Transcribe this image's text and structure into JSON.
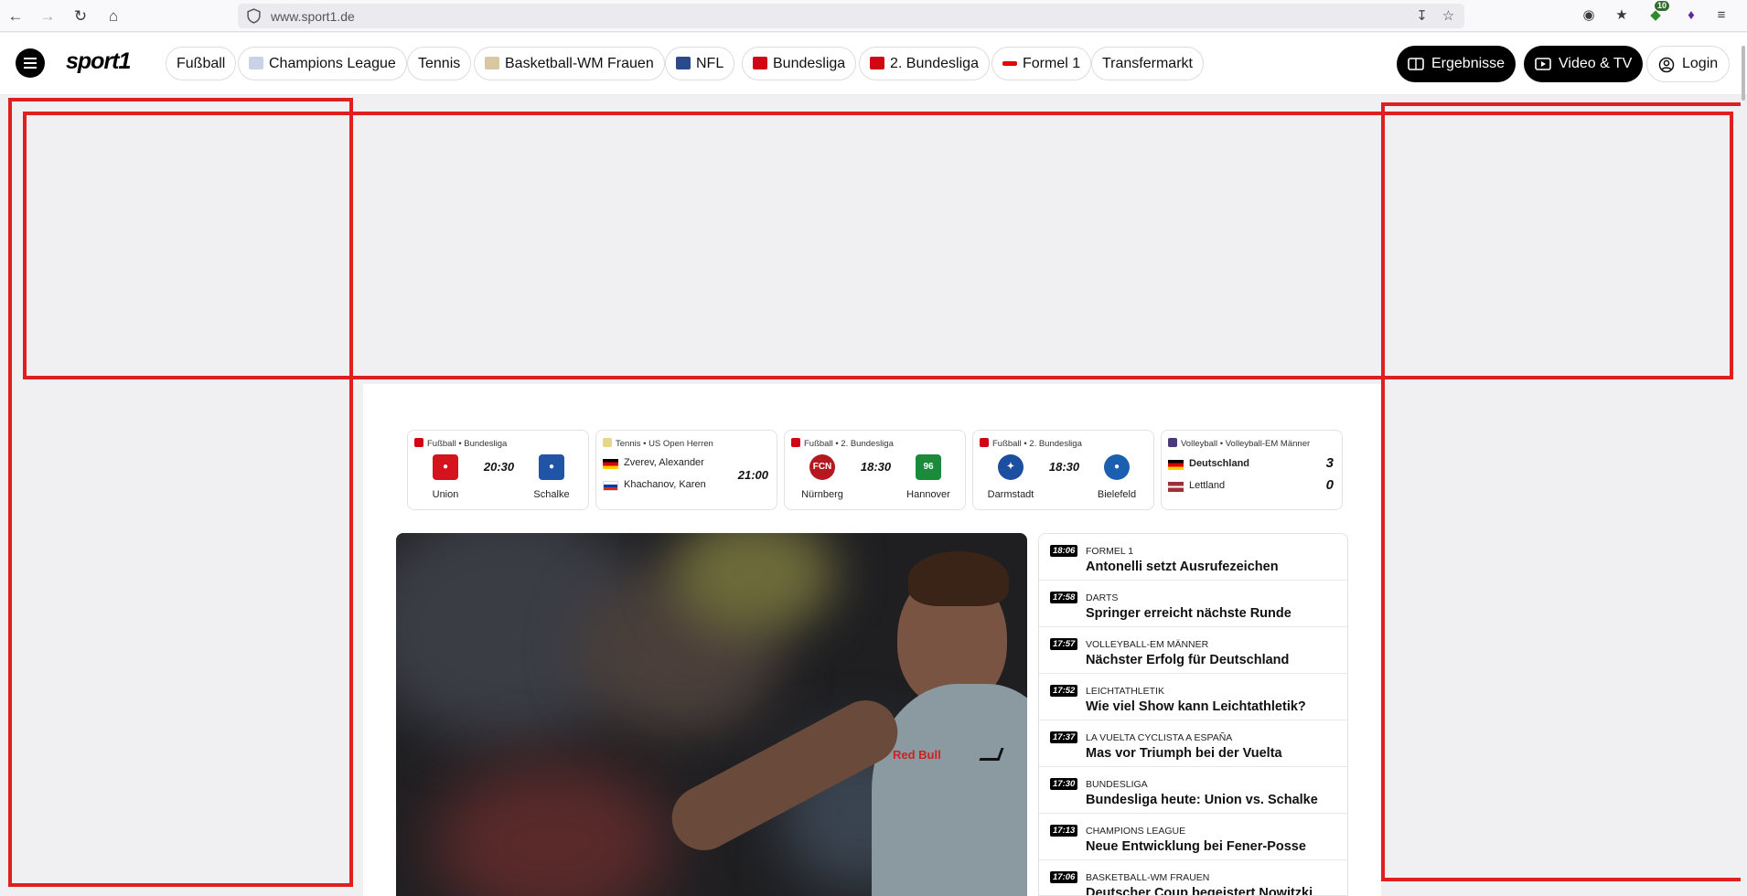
{
  "browser": {
    "url": "www.sport1.de",
    "extension_badge": "10"
  },
  "header": {
    "logo": "sport1",
    "nav_pills": [
      {
        "label": "Fußball"
      },
      {
        "label": "Champions League"
      },
      {
        "label": "Tennis"
      },
      {
        "label": "Basketball-WM Frauen"
      },
      {
        "label": "NFL"
      },
      {
        "label": "Bundesliga"
      },
      {
        "label": "2. Bundesliga"
      },
      {
        "label": "Formel 1"
      },
      {
        "label": "Transfermarkt"
      }
    ],
    "results_label": "Ergebnisse",
    "video_label": "Video & TV",
    "login_label": "Login"
  },
  "scores": [
    {
      "competition": "Fußball • Bundesliga",
      "home": "Union",
      "away": "Schalke",
      "time": "20:30"
    },
    {
      "competition": "Tennis • US Open Herren",
      "player1": "Zverev, Alexander",
      "player2": "Khachanov, Karen",
      "time": "21:00"
    },
    {
      "competition": "Fußball • 2. Bundesliga",
      "home": "Nürnberg",
      "away": "Hannover",
      "time": "18:30",
      "home_crest": "FCN",
      "away_crest": "96"
    },
    {
      "competition": "Fußball • 2. Bundesliga",
      "home": "Darmstadt",
      "away": "Bielefeld",
      "time": "18:30"
    },
    {
      "competition": "Volleyball • Volleyball-EM Männer",
      "team1": "Deutschland",
      "team2": "Lettland",
      "score1": "3",
      "score2": "0"
    }
  ],
  "hero": {
    "sponsor_text": "Red Bull"
  },
  "news": [
    {
      "time": "18:06",
      "category": "FORMEL 1",
      "title": "Antonelli setzt Ausrufezeichen"
    },
    {
      "time": "17:58",
      "category": "DARTS",
      "title": "Springer erreicht nächste Runde"
    },
    {
      "time": "17:57",
      "category": "VOLLEYBALL-EM MÄNNER",
      "title": "Nächster Erfolg für Deutschland"
    },
    {
      "time": "17:52",
      "category": "LEICHTATHLETIK",
      "title": "Wie viel Show kann Leichtathletik?"
    },
    {
      "time": "17:37",
      "category": "LA VUELTA CYCLISTA A ESPAÑA",
      "title": "Mas vor Triumph bei der Vuelta"
    },
    {
      "time": "17:30",
      "category": "BUNDESLIGA",
      "title": "Bundesliga heute: Union vs. Schalke"
    },
    {
      "time": "17:13",
      "category": "CHAMPIONS LEAGUE",
      "title": "Neue Entwicklung bei Fener-Posse"
    },
    {
      "time": "17:06",
      "category": "BASKETBALL-WM FRAUEN",
      "title": "Deutscher Coup begeistert Nowitzki"
    }
  ],
  "colors": {
    "accent_red": "#e02020",
    "page_bg": "#f0f0f2",
    "dark": "#000000"
  }
}
